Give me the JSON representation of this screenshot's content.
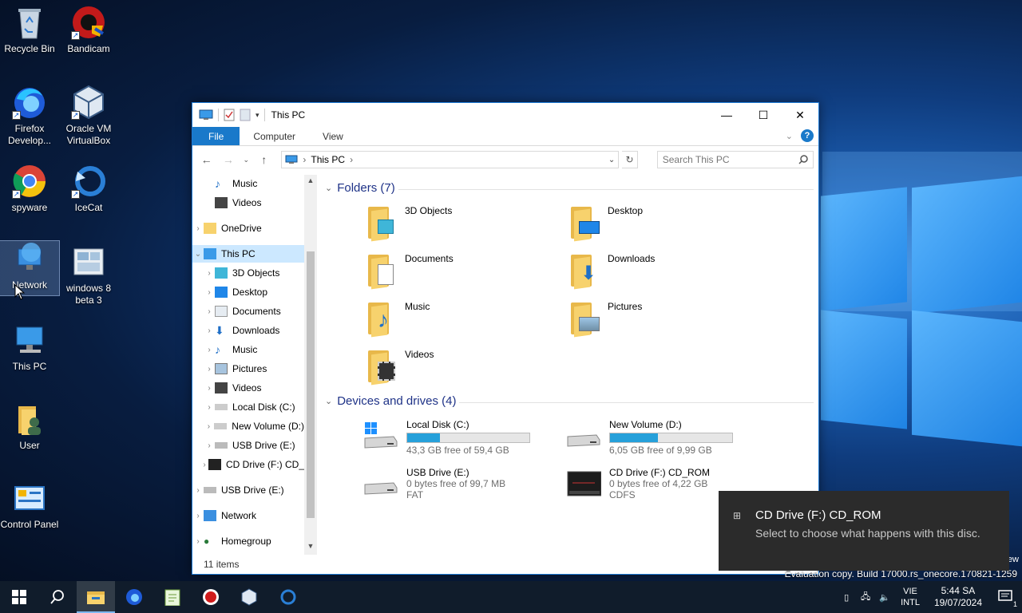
{
  "desktop": {
    "icons": [
      {
        "label": "Recycle Bin",
        "icon": "recycle-bin-icon"
      },
      {
        "label": "Bandicam",
        "icon": "bandicam-icon"
      },
      {
        "label": "Firefox Develop...",
        "icon": "firefox-dev-icon"
      },
      {
        "label": "Oracle VM VirtualBox",
        "icon": "virtualbox-icon"
      },
      {
        "label": "spyware",
        "icon": "chrome-icon"
      },
      {
        "label": "IceCat",
        "icon": "icecat-icon"
      },
      {
        "label": "Network",
        "icon": "network-icon"
      },
      {
        "label": "windows 8 beta 3",
        "icon": "images-icon"
      },
      {
        "label": "This PC",
        "icon": "this-pc-icon"
      },
      {
        "label": "User",
        "icon": "user-folder-icon"
      },
      {
        "label": "Control Panel",
        "icon": "control-panel-icon"
      }
    ]
  },
  "window": {
    "title": "This PC",
    "ribbon_tabs": [
      "File",
      "Computer",
      "View"
    ],
    "address_path": "This PC",
    "search_placeholder": "Search This PC",
    "status": "11 items"
  },
  "nav": {
    "items": [
      "Music",
      "Videos",
      "OneDrive",
      "This PC",
      "3D Objects",
      "Desktop",
      "Documents",
      "Downloads",
      "Music",
      "Pictures",
      "Videos",
      "Local Disk (C:)",
      "New Volume (D:)",
      "USB Drive (E:)",
      "CD Drive (F:) CD_",
      "USB Drive (E:)",
      "Network",
      "Homegroup"
    ]
  },
  "folders": {
    "header": "Folders (7)",
    "items": [
      "3D Objects",
      "Desktop",
      "Documents",
      "Downloads",
      "Music",
      "Pictures",
      "Videos"
    ]
  },
  "drives": {
    "header": "Devices and drives (4)",
    "items": [
      {
        "name": "Local Disk (C:)",
        "free": "43,3 GB free of 59,4 GB",
        "fs": "",
        "used_fraction": 0.27
      },
      {
        "name": "New Volume (D:)",
        "free": "6,05 GB free of 9,99 GB",
        "fs": "",
        "used_fraction": 0.39
      },
      {
        "name": "USB Drive (E:)",
        "free": "0 bytes free of 99,7 MB",
        "fs": "FAT"
      },
      {
        "name": "CD Drive (F:) CD_ROM",
        "free": "0 bytes free of 4,22 GB",
        "fs": "CDFS"
      }
    ]
  },
  "toast": {
    "title": "CD Drive (F:) CD_ROM",
    "body": "Select to choose what happens with this disc."
  },
  "watermark": {
    "line1": "ew",
    "line2": "Evaluation copy. Build 17000.rs_onecore.170821-1259"
  },
  "tray": {
    "lang1": "VIE",
    "lang2": "INTL",
    "time": "5:44 SA",
    "date": "19/07/2024",
    "notif_count": "1"
  },
  "colors": {
    "accent": "#1979ca",
    "selection": "#cce8ff",
    "progress": "#26a0da"
  }
}
